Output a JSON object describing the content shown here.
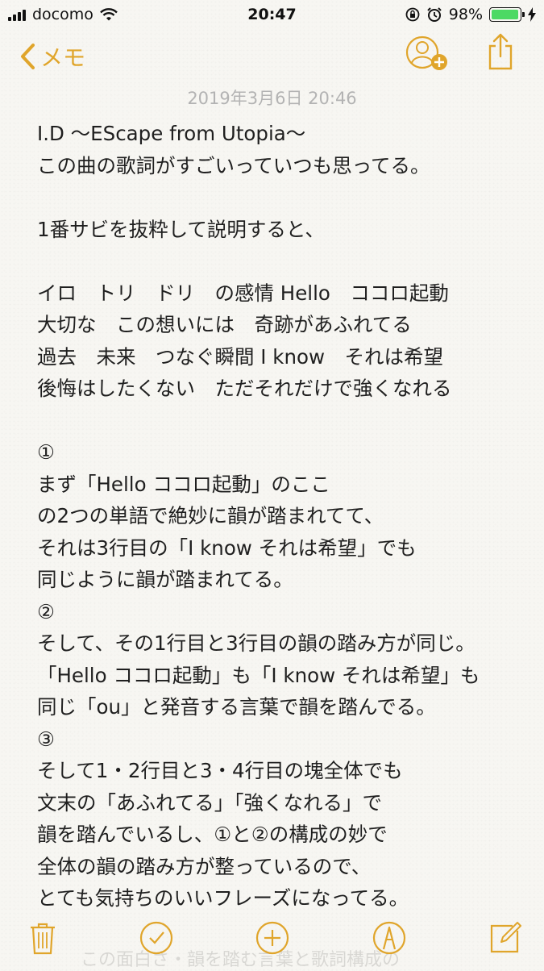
{
  "status": {
    "carrier": "docomo",
    "time": "20:47",
    "battery": "98%",
    "battery_level": 0.98
  },
  "nav": {
    "back_label": "メモ"
  },
  "note": {
    "date": "2019年3月6日 20:46",
    "lines": [
      "I.D 〜EScape from Utopia〜",
      "この曲の歌詞がすごいっていつも思ってる。",
      "",
      "1番サビを抜粋して説明すると、",
      "",
      "イロ　トリ　ドリ　の感情 Hello　ココロ起動",
      "大切な　この想いには　奇跡があふれてる",
      "過去　未来　つなぐ瞬間 I know　それは希望",
      "後悔はしたくない　ただそれだけで強くなれる",
      "",
      "①",
      "まず「Hello ココロ起動」のここ",
      "の2つの単語で絶妙に韻が踏まれてて、",
      "それは3行目の「I know それは希望」でも",
      "同じように韻が踏まれてる。",
      "②",
      "そして、その1行目と3行目の韻の踏み方が同じ。",
      "「Hello ココロ起動」も「I know それは希望」も",
      "同じ「ou」と発音する言葉で韻を踏んでる。",
      "③",
      "そして1・2行目と3・4行目の塊全体でも",
      "文末の「あふれてる」「強くなれる」で",
      "韻を踏んでいるし、①と②の構成の妙で",
      "全体の韻の踏み方が整っているので、",
      "とても気持ちのいいフレーズになってる。"
    ],
    "overflow_line": "この面白さ・韻を踏む言葉と歌詞構成の"
  },
  "colors": {
    "accent": "#e0a52b",
    "background": "#f7f6f2",
    "battery_fill": "#4cd964"
  },
  "icons": [
    "signal-icon",
    "wifi-icon",
    "rotation-lock-icon",
    "alarm-icon",
    "battery-icon",
    "charging-icon",
    "back-chevron-icon",
    "add-people-icon",
    "share-icon",
    "trash-icon",
    "checklist-icon",
    "add-icon",
    "markup-icon",
    "compose-icon"
  ]
}
